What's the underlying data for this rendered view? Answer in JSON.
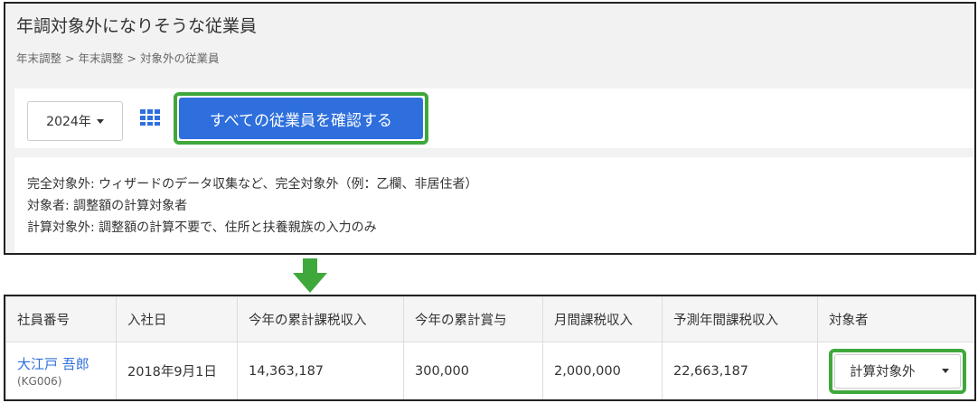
{
  "header": {
    "title": "年調対象外になりそうな従業員",
    "breadcrumb": [
      "年末調整",
      "年末調整",
      "対象外の従業員"
    ],
    "breadcrumb_separator": ">"
  },
  "toolbar": {
    "year_label": "2024年",
    "grid_icon": "grid-icon",
    "confirm_label": "すべての従業員を確認する"
  },
  "legend": {
    "lines": [
      "完全対象外: ウィザードのデータ収集など、完全対象外（例：乙欄、非居住者）",
      "対象者: 調整額の計算対象者",
      "計算対象外: 調整額の計算不要で、住所と扶養親族の入力のみ"
    ]
  },
  "table": {
    "headers": [
      "社員番号",
      "入社日",
      "今年の累計課税収入",
      "今年の累計賞与",
      "月間課税収入",
      "予測年間課税収入",
      "対象者"
    ],
    "rows": [
      {
        "name": "大江戸 吾郎",
        "code": "(KG006)",
        "hire_date": "2018年9月1日",
        "ytd_taxable": "14,363,187",
        "ytd_bonus": "300,000",
        "monthly_taxable": "2,000,000",
        "forecast_taxable": "22,663,187",
        "target": "計算対象外"
      }
    ]
  },
  "colors": {
    "primary": "#2e6fdd",
    "highlight": "#3fa83b",
    "panel_bg": "#f2f2f2"
  }
}
